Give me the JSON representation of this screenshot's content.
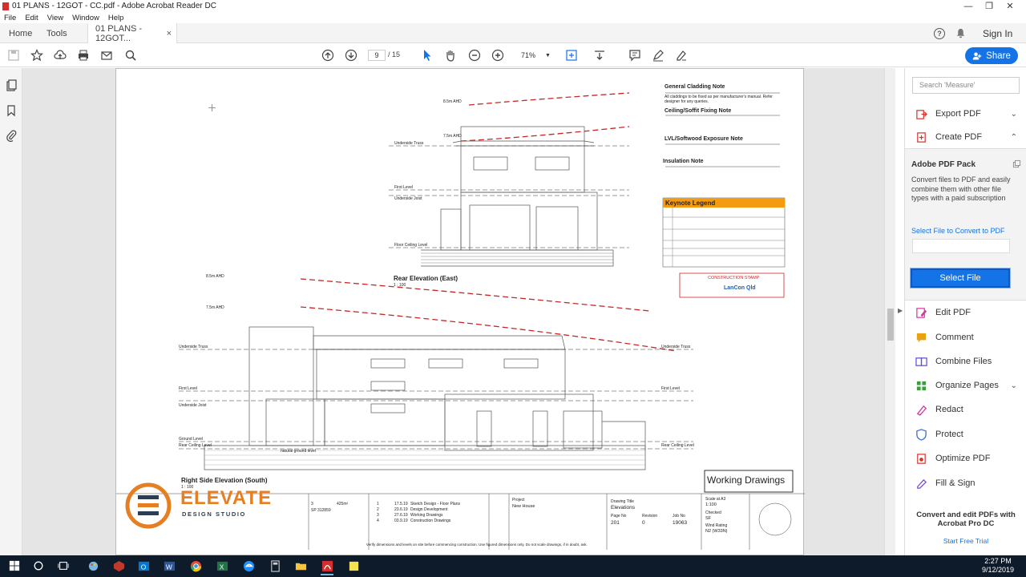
{
  "window": {
    "title": "01 PLANS - 12GOT - CC.pdf - Adobe Acrobat Reader DC",
    "controls": {
      "minimize": "—",
      "maximize": "❐",
      "close": "✕"
    }
  },
  "menu": [
    "File",
    "Edit",
    "View",
    "Window",
    "Help"
  ],
  "tabs": {
    "home": "Home",
    "tools": "Tools",
    "document": "01 PLANS - 12GOT...",
    "close": "×"
  },
  "header_right": {
    "help": "?",
    "sign_in": "Sign In"
  },
  "toolbar": {
    "current_page": "9",
    "total_pages": "/ 15",
    "zoom": "71%",
    "share_label": "Share"
  },
  "right_pane": {
    "search_placeholder": "Search 'Measure'",
    "export_pdf": "Export PDF",
    "create_pdf": "Create PDF",
    "pack_title": "Adobe PDF Pack",
    "pack_desc": "Convert files to PDF and easily combine them with other file types with a paid subscription",
    "select_link": "Select File to Convert to PDF",
    "select_button": "Select File",
    "tools": [
      {
        "label": "Edit PDF",
        "icon": "edit-pdf-icon",
        "color": "#d4379b"
      },
      {
        "label": "Comment",
        "icon": "comment-icon",
        "color": "#e8a313"
      },
      {
        "label": "Combine Files",
        "icon": "combine-files-icon",
        "color": "#5a4fcf"
      },
      {
        "label": "Organize Pages",
        "icon": "organize-pages-icon",
        "color": "#3e9b3e"
      },
      {
        "label": "Redact",
        "icon": "redact-icon",
        "color": "#d4379b"
      },
      {
        "label": "Protect",
        "icon": "protect-icon",
        "color": "#3c6fd6"
      },
      {
        "label": "Optimize PDF",
        "icon": "optimize-pdf-icon",
        "color": "#d9342b"
      },
      {
        "label": "Fill & Sign",
        "icon": "fill-sign-icon",
        "color": "#7a4fcf"
      }
    ],
    "promo": "Convert and edit PDFs with Acrobat Pro DC",
    "free_trial": "Start Free Trial"
  },
  "drawing": {
    "notes": {
      "cladding_title": "General Cladding Note",
      "cladding_text": "All claddings to be fixed as per manufacturer's manual. Refer designer for any queries.",
      "soffit_title": "Ceiling/Soffit Fixing Note",
      "lvl_title": "LVL/Softwood Exposure Note",
      "insulation_title": "Insulation Note",
      "keynote_title": "Keynote Legend",
      "construction_stamp": "CONSTRUCTION STAMP",
      "stamp_company": "LanCon Qld"
    },
    "rear_elevation": {
      "title": "Rear Elevation (East)",
      "scale": "1 : 100"
    },
    "side_elevation": {
      "title": "Right Side Elevation (South)",
      "scale": "1 : 100"
    },
    "working_drawings": "Working Drawings",
    "company": {
      "name": "ELEVATE",
      "sub": "DESIGN STUDIO"
    },
    "title_block": {
      "drawing_title_label": "Drawing Title",
      "drawing_title": "Elevations",
      "page_no_label": "Page No",
      "page_no": "201",
      "revision_label": "Revision",
      "revision": "0",
      "job_no_label": "Job No",
      "job_no": "19063",
      "project_label": "Project",
      "project": "New House",
      "scale_label": "Scale at A3",
      "scale": "1:100",
      "checked_label": "Checked",
      "checked": "SF",
      "wind_label": "Wind Rating",
      "wind": "N2 (W33N)",
      "lot": "3",
      "area": "425m²",
      "plan": "SP 312859"
    },
    "revisions": [
      {
        "rev": "1",
        "date": "17.5.19",
        "desc": "Sketch Design - Floor Plans"
      },
      {
        "rev": "2",
        "date": "23.6.19",
        "desc": "Design Development"
      },
      {
        "rev": "3",
        "date": "27.6.19",
        "desc": "Working Drawings"
      },
      {
        "rev": "4",
        "date": "03.9.19",
        "desc": "Construction Drawings"
      }
    ],
    "levels": {
      "underside_truss": "Underside Truss",
      "first_level": "First Level",
      "underside_joist": "Underside Joist",
      "floor_ceiling": "Floor Ceiling Level",
      "ground_level": "Ground Level",
      "rear_ceiling": "Rear Ceiling Level",
      "ahd1": "8.5m AHD",
      "ahd2": "7.5m AHD",
      "natural_ground": "natural ground level"
    },
    "footer_text": "Verify dimensions and levels on site before commencing construction. Use figured dimensions only. Do not scale drawings, if in doubt, ask."
  },
  "taskbar": {
    "time": "2:27 PM",
    "date": "9/12/2019"
  }
}
